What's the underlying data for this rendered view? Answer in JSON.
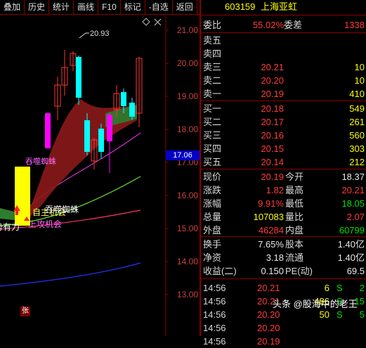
{
  "toolbar": {
    "buttons": [
      "叠加",
      "历史",
      "统计",
      "画线",
      "F10",
      "标记",
      "-自选",
      "返回"
    ]
  },
  "chart": {
    "price_labels": [
      "21.00",
      "20.00",
      "19.00",
      "18.00",
      "17.00",
      "16.00",
      "15.00",
      "14.00",
      "13.00"
    ],
    "current_price_tag": "17.06",
    "high_label": "20.93",
    "annotations": [
      "吞噬蜘蛛",
      "自主机会",
      "蓄势有力",
      "上攻机会",
      "吞噬蜘蛛"
    ],
    "zhang_badge": "张",
    "colors": {
      "bull": "#ff00ff",
      "bear": "#00ffff",
      "ribbon": "#8b1a1a",
      "ribbon_green": "#2e7d2e"
    }
  },
  "quote": {
    "code": "603159",
    "name": "上海亚虹",
    "weibi_label": "委比",
    "weibi": "55.02%",
    "weicha_label": "委差",
    "weicha": "1338",
    "asks": [
      {
        "label": "卖五",
        "price": "",
        "vol": ""
      },
      {
        "label": "卖四",
        "price": "",
        "vol": ""
      },
      {
        "label": "卖三",
        "price": "20.21",
        "vol": "10"
      },
      {
        "label": "卖二",
        "price": "20.20",
        "vol": "10"
      },
      {
        "label": "卖一",
        "price": "20.19",
        "vol": "410"
      }
    ],
    "bids": [
      {
        "label": "买一",
        "price": "20.18",
        "vol": "549"
      },
      {
        "label": "买二",
        "price": "20.17",
        "vol": "261"
      },
      {
        "label": "买三",
        "price": "20.16",
        "vol": "560"
      },
      {
        "label": "买四",
        "price": "20.15",
        "vol": "303"
      },
      {
        "label": "买五",
        "price": "20.14",
        "vol": "212"
      }
    ],
    "stats": [
      {
        "l1": "现价",
        "v1": "20.19",
        "c1": "red",
        "l2": "今开",
        "v2": "18.37",
        "c2": "white"
      },
      {
        "l1": "涨跌",
        "v1": "1.82",
        "c1": "red",
        "l2": "最高",
        "v2": "20.21",
        "c2": "red"
      },
      {
        "l1": "涨幅",
        "v1": "9.91%",
        "c1": "red",
        "l2": "最低",
        "v2": "18.05",
        "c2": "green"
      },
      {
        "l1": "总量",
        "v1": "107083",
        "c1": "yellow",
        "l2": "量比",
        "v2": "2.07",
        "c2": "red"
      },
      {
        "l1": "外盘",
        "v1": "46284",
        "c1": "red",
        "l2": "内盘",
        "v2": "60799",
        "c2": "green"
      }
    ],
    "stats2": [
      {
        "l1": "换手",
        "v1": "7.65%",
        "l2": "股本",
        "v2": "1.40亿"
      },
      {
        "l1": "净资",
        "v1": "3.18",
        "l2": "流通",
        "v2": "1.40亿"
      },
      {
        "l1": "收益(二)",
        "v1": "0.150",
        "l2": "PE(动)",
        "v2": "69.5"
      }
    ],
    "ticks": [
      {
        "time": "14:56",
        "price": "20.21",
        "vol": "6",
        "side": "S",
        "n": "2"
      },
      {
        "time": "14:56",
        "price": "20.21",
        "vol": "486",
        "side": "S",
        "n": "15"
      },
      {
        "time": "14:56",
        "price": "20.20",
        "vol": "50",
        "side": "S",
        "n": "5"
      },
      {
        "time": "14:56",
        "price": "20.20",
        "vol": "",
        "side": "",
        "n": ""
      },
      {
        "time": "14:56",
        "price": "20.19",
        "vol": "",
        "side": "",
        "n": ""
      }
    ]
  },
  "watermark": "头条 @股海中的老王"
}
